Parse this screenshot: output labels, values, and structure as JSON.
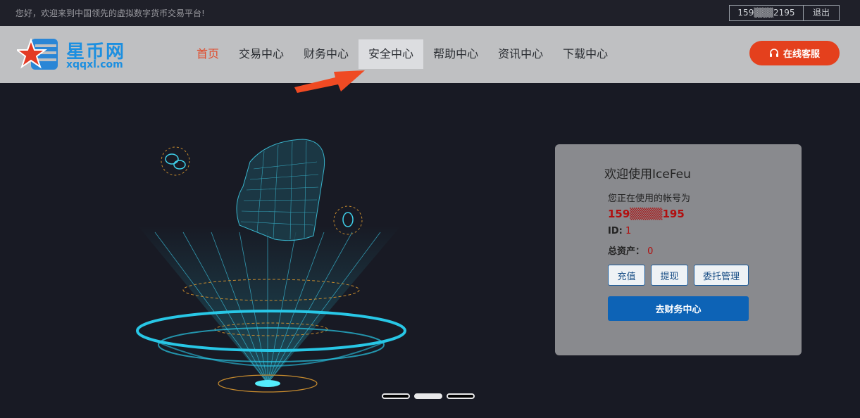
{
  "topbar": {
    "welcome": "您好，欢迎来到中国领先的虚拟数字货币交易平台!",
    "phone_masked": "159▒▒▒2195",
    "logout": "退出"
  },
  "logo": {
    "cn": "星币网",
    "en": "xqqxl.com"
  },
  "nav": {
    "items": [
      {
        "label": "首页"
      },
      {
        "label": "交易中心"
      },
      {
        "label": "财务中心"
      },
      {
        "label": "安全中心"
      },
      {
        "label": "帮助中心"
      },
      {
        "label": "资讯中心"
      },
      {
        "label": "下载中心"
      }
    ],
    "service": "在线客服"
  },
  "card": {
    "title": "欢迎使用IceFeu",
    "account_label": "您正在使用的帐号为",
    "phone_masked": "159▒▒▒▒195",
    "id_label": "ID:",
    "id_value": "1",
    "assets_label": "总资产：",
    "assets_value": "0",
    "btn_recharge": "充值",
    "btn_withdraw": "提现",
    "btn_orders": "委托管理",
    "btn_finance": "去财务中心"
  },
  "colors": {
    "accent": "#e4401d",
    "primary": "#0d63b6",
    "highlight_red": "#b10f0f"
  },
  "slider": {
    "active_index": 1,
    "count": 3
  }
}
